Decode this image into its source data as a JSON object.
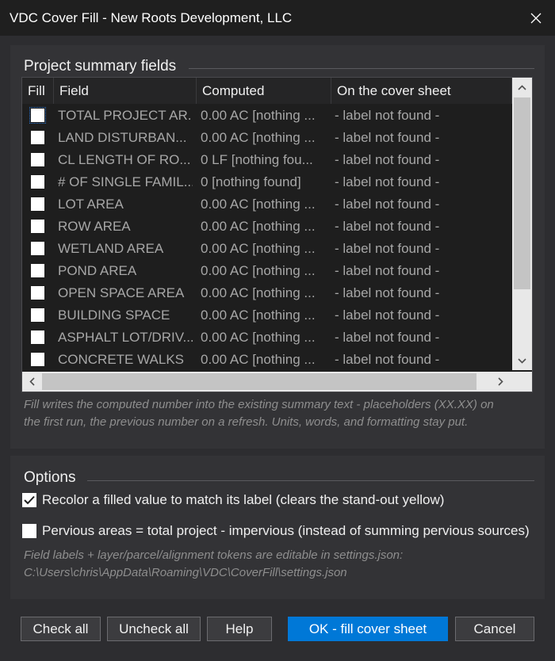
{
  "window": {
    "title": "VDC Cover Fill - New Roots Development, LLC"
  },
  "summary": {
    "legend": "Project summary fields",
    "columns": {
      "fill": "Fill",
      "field": "Field",
      "computed": "Computed",
      "cover": "On the cover sheet"
    },
    "rows": [
      {
        "field": "TOTAL PROJECT AR...",
        "computed": "0.00 AC  [nothing ...",
        "cover": "- label not found -",
        "checked": false
      },
      {
        "field": "LAND DISTURBAN...",
        "computed": "0.00 AC  [nothing ...",
        "cover": "- label not found -",
        "checked": false
      },
      {
        "field": "CL LENGTH OF RO...",
        "computed": "0 LF  [nothing fou...",
        "cover": "- label not found -",
        "checked": false
      },
      {
        "field": "# OF SINGLE FAMIL...",
        "computed": "0  [nothing found]",
        "cover": "- label not found -",
        "checked": false
      },
      {
        "field": "LOT AREA",
        "computed": "0.00 AC  [nothing ...",
        "cover": "- label not found -",
        "checked": false
      },
      {
        "field": "ROW AREA",
        "computed": "0.00 AC  [nothing ...",
        "cover": "- label not found -",
        "checked": false
      },
      {
        "field": "WETLAND AREA",
        "computed": "0.00 AC  [nothing ...",
        "cover": "- label not found -",
        "checked": false
      },
      {
        "field": "POND AREA",
        "computed": "0.00 AC  [nothing ...",
        "cover": "- label not found -",
        "checked": false
      },
      {
        "field": "OPEN SPACE AREA",
        "computed": "0.00 AC  [nothing ...",
        "cover": "- label not found -",
        "checked": false
      },
      {
        "field": "BUILDING SPACE",
        "computed": "0.00 AC  [nothing ...",
        "cover": "- label not found -",
        "checked": false
      },
      {
        "field": "ASPHALT LOT/DRIV...",
        "computed": "0.00 AC  [nothing ...",
        "cover": "- label not found -",
        "checked": false
      },
      {
        "field": "CONCRETE WALKS",
        "computed": "0.00 AC  [nothing ...",
        "cover": "- label not found -",
        "checked": false
      }
    ],
    "note_line1": "Fill writes the computed number into the existing summary text - placeholders (XX.XX) on",
    "note_line2": "the first run, the previous number on a refresh. Units, words, and formatting stay put."
  },
  "options": {
    "legend": "Options",
    "recolor": {
      "label": "Recolor a filled value to match its label (clears the stand-out yellow)",
      "checked": true
    },
    "pervious": {
      "label": "Pervious areas = total project - impervious (instead of summing pervious sources)",
      "checked": false
    },
    "note_line1": "Field labels + layer/parcel/alignment tokens are editable in settings.json:",
    "note_line2": "C:\\Users\\chris\\AppData\\Roaming\\VDC\\CoverFill\\settings.json"
  },
  "buttons": {
    "check_all": "Check all",
    "uncheck_all": "Uncheck all",
    "help": "Help",
    "ok": "OK - fill cover sheet",
    "cancel": "Cancel"
  },
  "colors": {
    "accent": "#0078d7",
    "background": "#2d2d30",
    "grid": "#1e1e1e"
  }
}
